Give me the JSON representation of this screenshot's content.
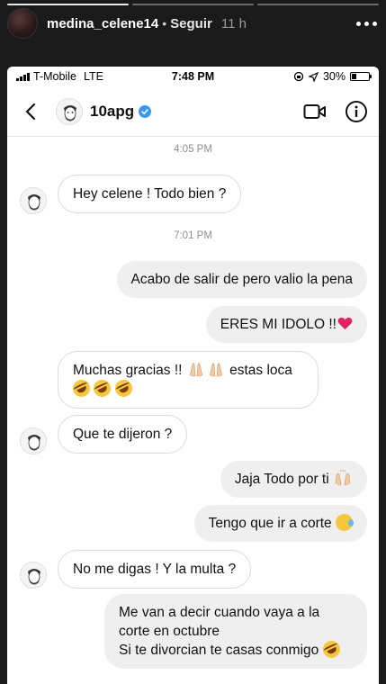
{
  "story": {
    "username": "medina_celene14",
    "separator": "•",
    "follow_label": "Seguir",
    "time_ago": "11 h"
  },
  "status_bar": {
    "carrier": "T-Mobile",
    "network": "LTE",
    "time": "7:48 PM",
    "battery": "30%",
    "battery_level": 0.3
  },
  "dm": {
    "username": "10apg",
    "verified": true
  },
  "thread": {
    "stamp_1": "4:05 PM",
    "stamp_2": "7:01 PM",
    "m1": "Hey celene ! Todo bien ?",
    "m2": "Acabo de salir de pero valio la pena",
    "m3": "ERES MI IDOLO !!",
    "m4_a": "Muchas gracias !!",
    "m4_b": "estas loca",
    "m5": "Que te dijeron ?",
    "m6": "Jaja Todo por ti",
    "m7": "Tengo que ir a corte",
    "m8": "No me digas ! Y la multa ?",
    "m9_line1": "Me van a decir cuando vaya a la",
    "m9_line2": "corte en octubre",
    "m9_line3": "Si te divorcian te casas conmigo"
  },
  "icons": {
    "heart": "red-heart",
    "rofl": "rolling-on-floor-laughing",
    "pray": "folded-hands",
    "praise": "raising-hands",
    "sleepy": "sleepy-face"
  },
  "colors": {
    "verified": "#3897f0",
    "heart": "#e0245e",
    "story_bg": "#1a1a1a",
    "bubble_out": "#efefef"
  }
}
